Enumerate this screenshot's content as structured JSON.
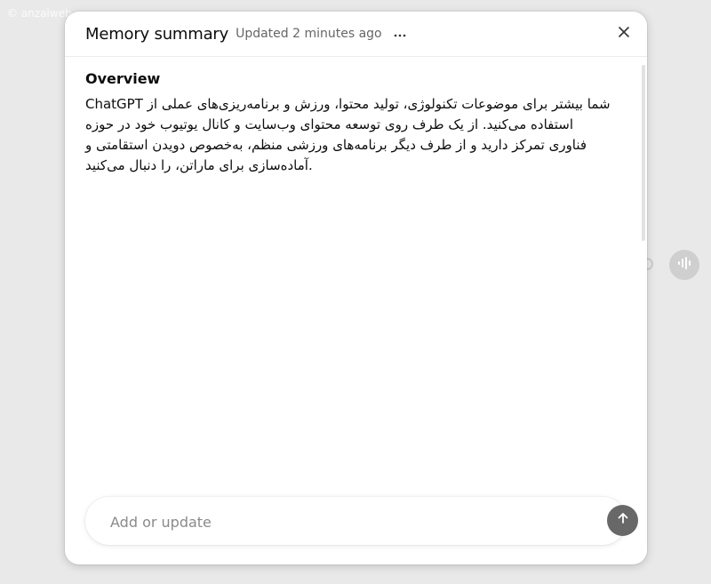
{
  "watermark": "© anzalweb",
  "modal": {
    "title": "Memory summary",
    "updated": "Updated 2 minutes ago",
    "more_icon": "ellipsis-icon",
    "close_icon": "close-icon"
  },
  "overview": {
    "heading": "Overview",
    "text": "ChatGPT شما بیشتر برای موضوعات تکنولوژی، تولید محتوا، ورزش و برنامه‌ریزی‌های عملی از استفاده می‌کنید. از یک طرف روی توسعه محتوای وب‌سایت و کانال یوتیوب خود در حوزه فناوری تمرکز دارید و از طرف دیگر برنامه‌های ورزشی منظم، به‌خصوص دویدن استقامتی و آماده‌سازی برای ماراتن، را دنبال می‌کنید."
  },
  "input": {
    "placeholder": "Add or update",
    "value": "",
    "send_icon": "arrow-up-icon"
  },
  "colors": {
    "send_button": "#686868",
    "background": "#e9e9e9"
  }
}
